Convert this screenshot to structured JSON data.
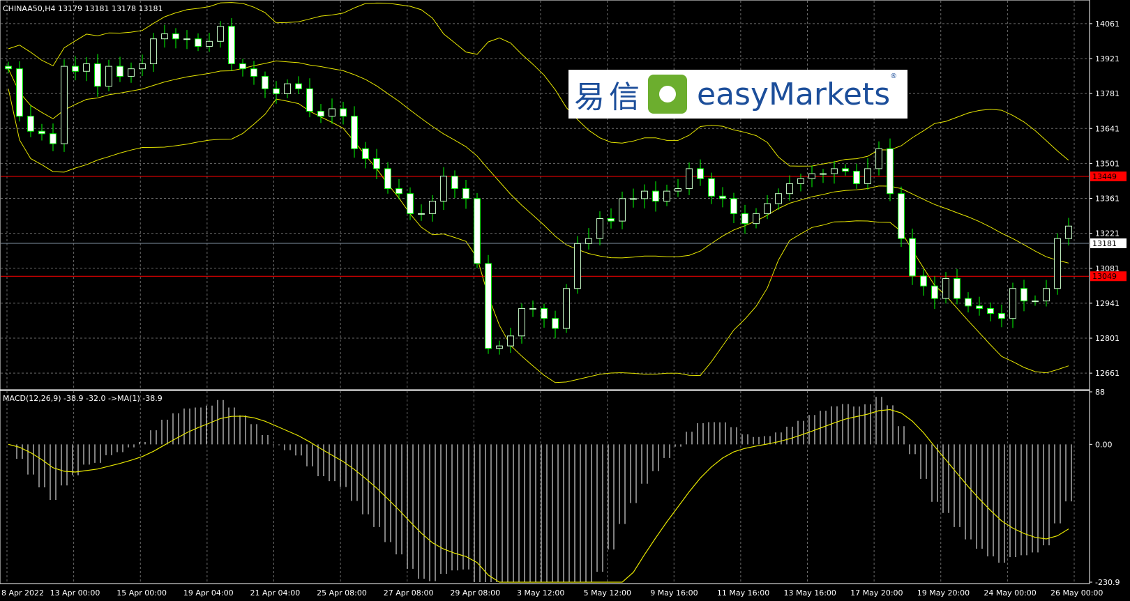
{
  "header": {
    "main": "CHINAA50,H4  13179 13181 13178 13181",
    "indicator": "MACD(12,26,9) -38.9 -32.0   ->MA(1) -38.9"
  },
  "logo": {
    "chinese": "易信",
    "brand": "easyMarkets",
    "mark": "®"
  },
  "colors": {
    "bull": "#ccffcc",
    "bear": "#ffffff",
    "wick": "#00ff00",
    "bands": "#e6e600",
    "signal": "#e6e600",
    "hist": "#ffffff",
    "level": "#ff0000",
    "grid": "#6a6a6a",
    "current": "#7f8f9f"
  },
  "chart_data": [
    {
      "type": "candlestick",
      "symbol": "CHINAA50",
      "timeframe": "H4",
      "quote": {
        "open": 13179,
        "high": 13181,
        "low": 13178,
        "close": 13181
      },
      "y_ticks": [
        14061,
        13921,
        13781,
        13641,
        13501,
        13361,
        13221,
        13081,
        12941,
        12801,
        12661
      ],
      "ylim": [
        12600,
        14150
      ],
      "price_tags": [
        {
          "value": 13449,
          "label": "13449",
          "kind": "level"
        },
        {
          "value": 13181,
          "label": "13181",
          "kind": "current"
        },
        {
          "value": 13049,
          "label": "13049",
          "kind": "level"
        }
      ],
      "x_labels": [
        "8 Apr 2022",
        "13 Apr 00:00",
        "15 Apr 00:00",
        "19 Apr 04:00",
        "21 Apr 04:00",
        "25 Apr 08:00",
        "27 Apr 08:00",
        "29 Apr 08:00",
        "3 May 12:00",
        "5 May 12:00",
        "9 May 16:00",
        "11 May 16:00",
        "13 May 16:00",
        "17 May 20:00",
        "19 May 20:00",
        "24 May 00:00",
        "26 May 00:00"
      ],
      "bars": 96,
      "close": [
        13880,
        13690,
        13630,
        13620,
        13580,
        13890,
        13870,
        13900,
        13810,
        13890,
        13850,
        13880,
        13900,
        14000,
        14020,
        14000,
        14000,
        13970,
        13990,
        14050,
        13900,
        13880,
        13850,
        13800,
        13780,
        13820,
        13800,
        13710,
        13690,
        13720,
        13690,
        13560,
        13520,
        13480,
        13400,
        13380,
        13300,
        13300,
        13350,
        13450,
        13400,
        13360,
        13100,
        12760,
        12770,
        12810,
        12920,
        12920,
        12880,
        12840,
        13000,
        13180,
        13200,
        13280,
        13270,
        13360,
        13360,
        13390,
        13350,
        13390,
        13400,
        13480,
        13440,
        13370,
        13360,
        13300,
        13260,
        13300,
        13340,
        13380,
        13420,
        13440,
        13460,
        13460,
        13480,
        13470,
        13420,
        13480,
        13560,
        13380,
        13200,
        13050,
        13010,
        12960,
        13040,
        12960,
        12930,
        12920,
        12900,
        12880,
        13000,
        12950,
        12950,
        13000,
        13200,
        13250
      ]
    },
    {
      "type": "histogram",
      "indicator": "MACD",
      "params": "12,26,9",
      "macd": -38.9,
      "signal": -32.0,
      "y_ticks": [
        88,
        0.0,
        -230.9
      ],
      "y_tick_labels": [
        "88",
        "0.00",
        "-230.9"
      ],
      "ylim": [
        -230.9,
        88
      ]
    }
  ]
}
